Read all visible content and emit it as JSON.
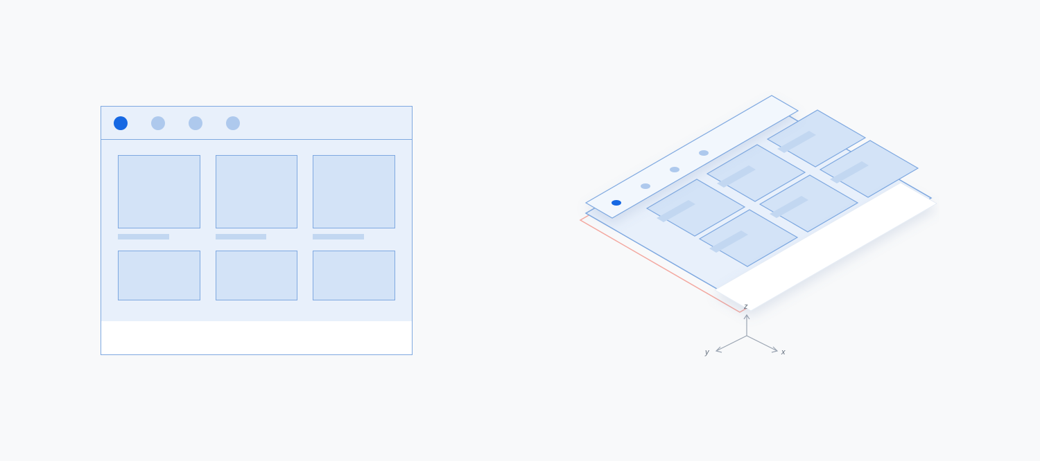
{
  "diagram": {
    "description": "Flat UI wireframe (left) and its isometric layered decomposition (right) with a 3D axis indicator.",
    "colors": {
      "stroke_blue": "#7EA8E0",
      "panel_blue": "#e8f0fb",
      "thumb_fill": "#D3E3F7",
      "caption_fill": "#C2D7F1",
      "dot_active": "#1668E3",
      "dot_inactive": "#AEC9ED",
      "shadow_red": "#F3A8A0",
      "background": "#f8f9fa"
    },
    "flat_window": {
      "tabs": [
        {
          "active": true
        },
        {
          "active": false
        },
        {
          "active": false
        },
        {
          "active": false
        }
      ],
      "grid": {
        "cols": 3,
        "rows": 2
      }
    },
    "isometric": {
      "layers": [
        "red-outline",
        "main-surface",
        "titlebar-plane",
        "floating-panel"
      ],
      "axes": {
        "x": "x",
        "y": "y",
        "z": "z"
      }
    }
  }
}
